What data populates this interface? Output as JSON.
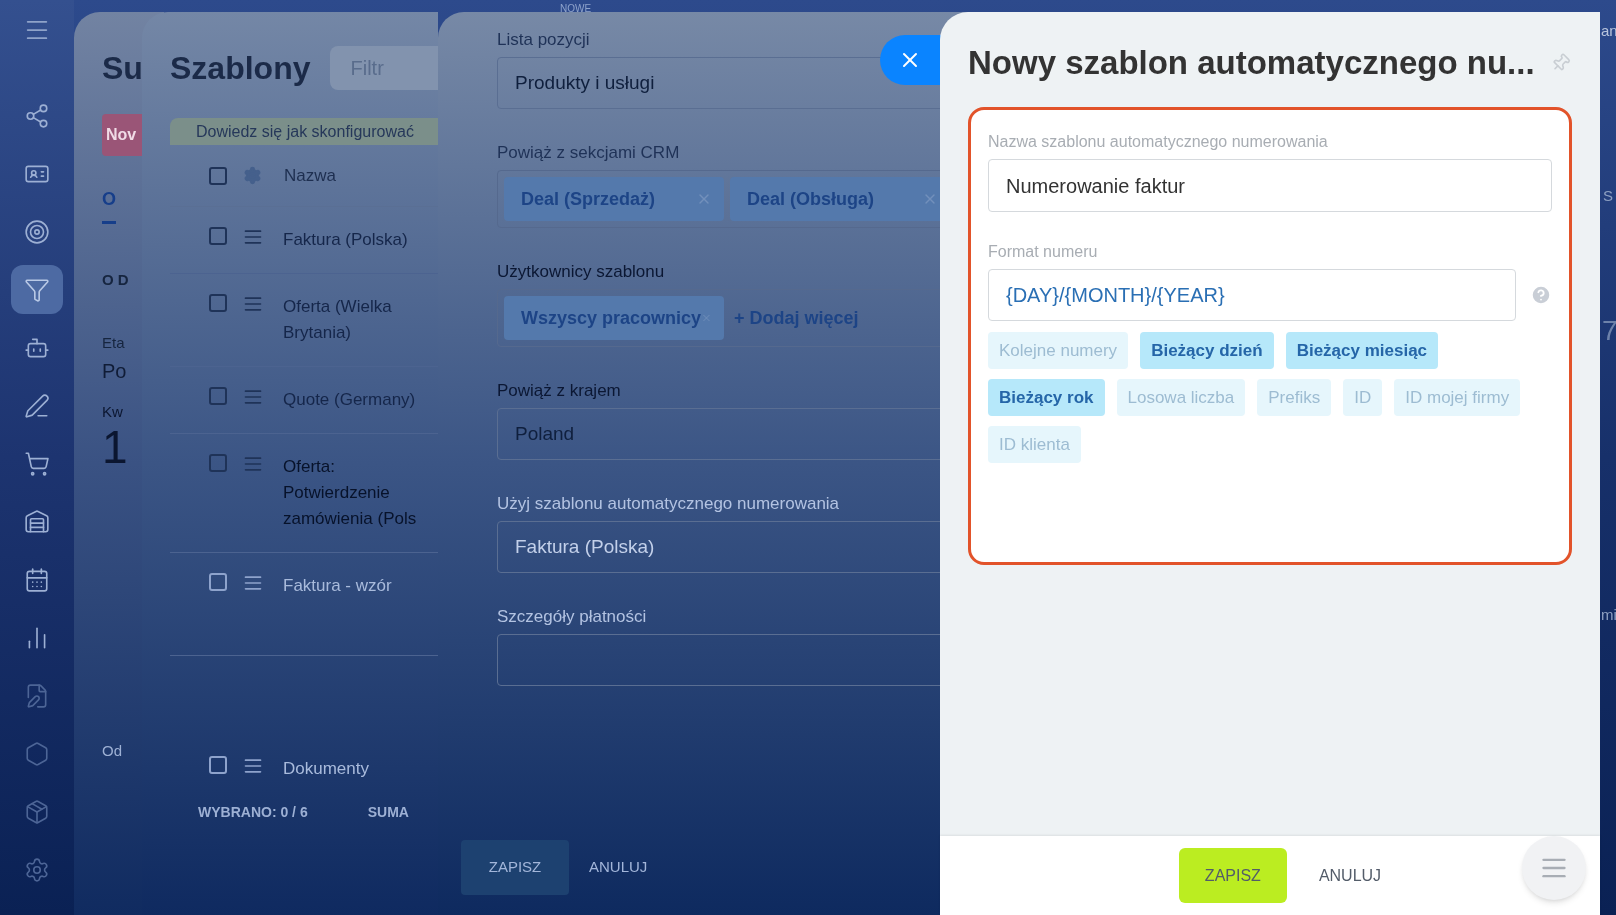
{
  "sidebar": {
    "items": [
      {
        "kind": "nodes",
        "selected": false
      },
      {
        "kind": "card",
        "selected": false
      },
      {
        "kind": "target",
        "selected": false
      },
      {
        "kind": "funnel",
        "selected": true
      },
      {
        "kind": "robot",
        "selected": false
      },
      {
        "kind": "pen",
        "selected": false
      },
      {
        "kind": "cart",
        "selected": false
      },
      {
        "kind": "warehouse",
        "selected": false
      },
      {
        "kind": "calendar",
        "selected": false
      },
      {
        "kind": "chart",
        "selected": false
      },
      {
        "kind": "file",
        "selected": false
      },
      {
        "kind": "hexagon",
        "selected": false
      },
      {
        "kind": "package",
        "selected": false
      },
      {
        "kind": "settings",
        "selected": false
      }
    ]
  },
  "top_label": "NOWE",
  "background_panel": {
    "title": "Su",
    "button": "Nov",
    "tab": "O",
    "section": "O D",
    "field_label": "Eta",
    "field_value": "Po",
    "label_2": "Kw",
    "value_2": "1",
    "footer_label": "Od"
  },
  "templates_panel": {
    "title": "Szablony",
    "filter_placeholder": "Filtr",
    "banner": "Dowiedz się jak skonfigurować",
    "header": "Nazwa",
    "header_checked": false,
    "rows": [
      {
        "name": "Faktura (Polska)",
        "checked": false
      },
      {
        "name": "Oferta (Wielka Brytania)",
        "checked": false
      },
      {
        "name": "Quote (Germany)",
        "checked": false
      },
      {
        "name": "Oferta: Potwierdzenie zamówienia (Pols",
        "checked": false
      },
      {
        "name": "Faktura - wzór",
        "checked": false
      },
      {
        "name": "Dokumenty",
        "checked": false
      }
    ],
    "footer": [
      "WYBRANO: 0 / 6",
      "SUMA"
    ]
  },
  "form_panel": {
    "fields": [
      {
        "kind": "input",
        "label": "Lista pozycji",
        "value": "Produkty i usługi"
      },
      {
        "kind": "tags",
        "label": "Powiąż z sekcjami CRM",
        "tags": [
          "Deal (Sprzedaż)",
          "Deal (Obsługa)"
        ]
      },
      {
        "kind": "tags",
        "label": "Użytkownicy szablonu",
        "tags": [
          "Wszyscy pracownicy"
        ],
        "add_link": "+ Dodaj więcej"
      },
      {
        "kind": "input",
        "label": "Powiąż z krajem",
        "value": "Poland"
      },
      {
        "kind": "input",
        "label": "Użyj szablonu automatycznego numerowania",
        "value": "Faktura (Polska)"
      },
      {
        "kind": "input",
        "label": "Szczegóły płatności"
      }
    ],
    "buttons": [
      "ZAPISZ",
      "ANULUJ"
    ]
  },
  "dialog": {
    "title": "Nowy szablon automatycznego nu...",
    "name_field": {
      "label": "Nazwa szablonu automatycznego numerowania",
      "value": "Numerowanie faktur"
    },
    "format_field": {
      "label": "Format numeru",
      "value": "{DAY}/{MONTH}/{YEAR}"
    },
    "macros": [
      {
        "label": "Kolejne numery",
        "selected": false
      },
      {
        "label": "Bieżący dzień",
        "selected": true
      },
      {
        "label": "Bieżący miesiąc",
        "selected": true
      },
      {
        "label": "Bieżący rok",
        "selected": true
      },
      {
        "label": "Losowa liczba",
        "selected": false
      },
      {
        "label": "Prefiks",
        "selected": false
      },
      {
        "label": "ID",
        "selected": false
      },
      {
        "label": "ID mojej firmy",
        "selected": false
      },
      {
        "label": "ID klienta",
        "selected": false
      }
    ],
    "buttons": [
      {
        "kind": "primary",
        "label": "ZAPISZ"
      },
      {
        "kind": "link",
        "label": "ANULUJ"
      }
    ]
  },
  "edge_fragments": [
    "an",
    "S",
    "7",
    "mi"
  ]
}
